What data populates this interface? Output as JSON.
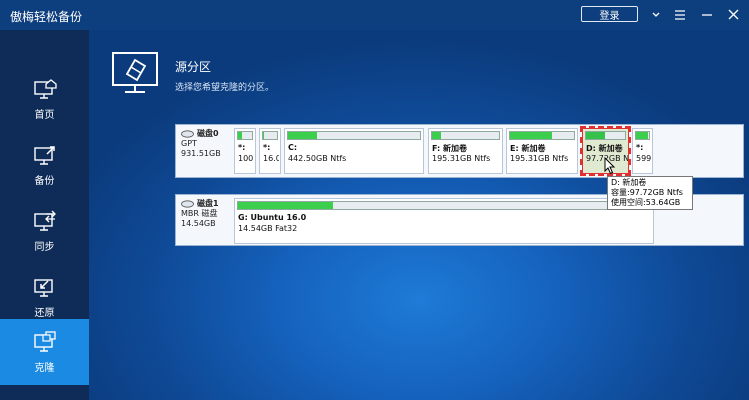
{
  "app": {
    "title": "傲梅轻松备份"
  },
  "titlebar": {
    "login_label": "登录"
  },
  "sidebar": {
    "items": [
      {
        "label": "首页",
        "icon": "home-icon"
      },
      {
        "label": "备份",
        "icon": "backup-icon"
      },
      {
        "label": "同步",
        "icon": "sync-icon"
      },
      {
        "label": "还原",
        "icon": "restore-icon"
      },
      {
        "label": "克隆",
        "icon": "clone-icon",
        "active": true
      }
    ]
  },
  "main": {
    "title": "源分区",
    "subtitle": "选择您希望克隆的分区。"
  },
  "disks": [
    {
      "name": "磁盘0",
      "type": "GPT",
      "size": "931.51GB",
      "partitions": [
        {
          "name": "*:",
          "info": "100...",
          "fill_ratio": 0.3
        },
        {
          "name": "*:",
          "info": "16.0...",
          "fill_ratio": 0.05
        },
        {
          "name": "C:",
          "info": "442.50GB Ntfs",
          "fill_ratio": 0.22
        },
        {
          "name": "F: 新加卷",
          "info": "195.31GB Ntfs",
          "fill_ratio": 0.14
        },
        {
          "name": "E: 新加卷",
          "info": "195.31GB Ntfs",
          "fill_ratio": 0.65
        },
        {
          "name": "D: 新加卷",
          "info": "97.72GB Ntfs",
          "fill_ratio": 0.48,
          "selected": true
        },
        {
          "name": "*:",
          "info": "599...",
          "fill_ratio": 0.9
        }
      ]
    },
    {
      "name": "磁盘1",
      "type": "MBR 磁盘",
      "size": "14.54GB",
      "partitions": [
        {
          "name": "G: Ubuntu 16.0",
          "info": "14.54GB Fat32",
          "fill_ratio": 0.23
        }
      ]
    }
  ],
  "tooltip": {
    "line1": "D: 新加卷",
    "line2": "容量:97.72GB Ntfs",
    "line3": "使用空间:53.64GB"
  },
  "colors": {
    "titlebar": "#0d3e7d",
    "sidebar": "#0f2c58",
    "sidebar_active": "#1b8ae2",
    "usage_fill": "#3ccf4e",
    "selection_outline": "#e03030"
  }
}
